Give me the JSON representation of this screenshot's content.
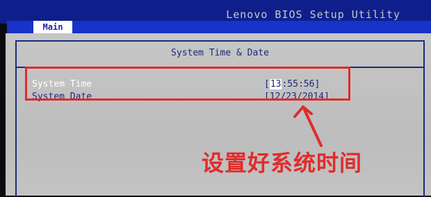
{
  "header": {
    "title": "Lenovo BIOS Setup Utility",
    "tabs": [
      {
        "label": "Main",
        "active": true
      }
    ]
  },
  "panel": {
    "title": "System Time & Date",
    "items": [
      {
        "label": "System Time",
        "value_prefix": "[",
        "value_cursor": "13",
        "value_rest": ":55:56]",
        "selected": true
      },
      {
        "label": "System Date",
        "value": "[12/23/2014]",
        "selected": false
      }
    ]
  },
  "annotation": {
    "note": "设置好系统时间",
    "color": "#e02b2b"
  },
  "colors": {
    "header_bg": "#0e1f8b",
    "tab_bg": "#1733c8",
    "content_bg": "#c6c6c6",
    "text_blue": "#1b2a78",
    "highlight": "#e02b2b"
  }
}
